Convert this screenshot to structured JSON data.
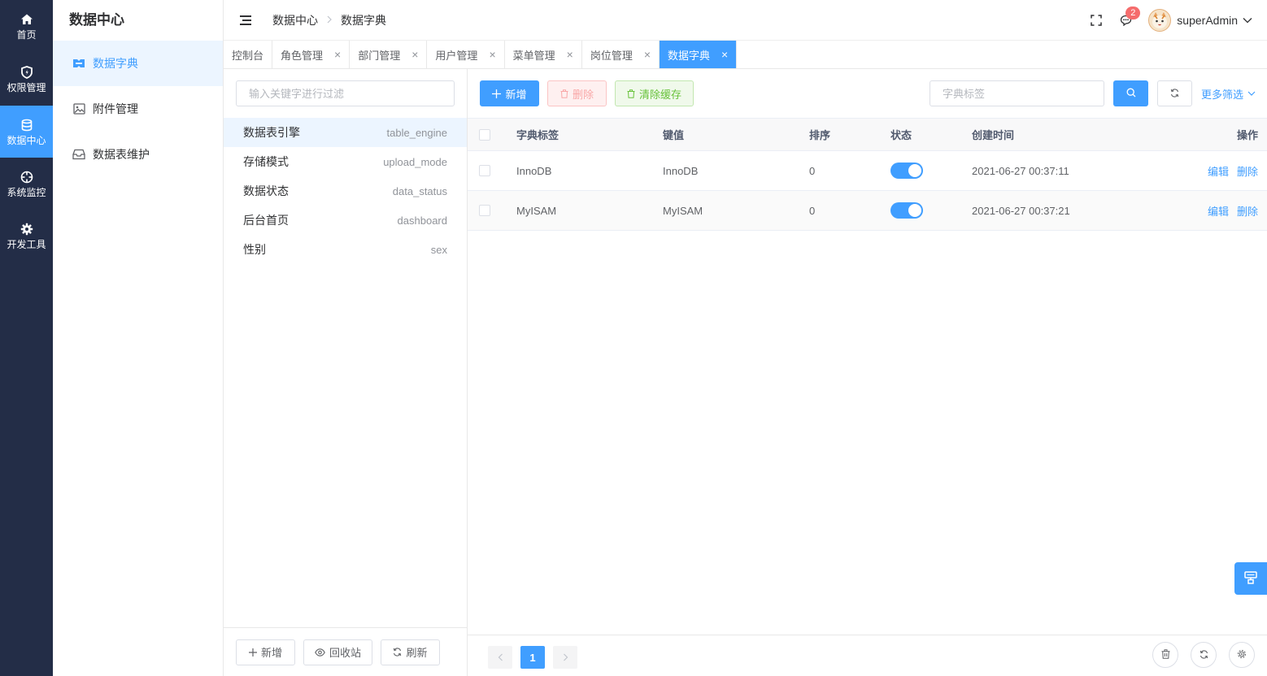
{
  "rail": {
    "items": [
      {
        "label": "首页",
        "icon": "home-icon"
      },
      {
        "label": "权限管理",
        "icon": "shield-icon"
      },
      {
        "label": "数据中心",
        "icon": "database-icon"
      },
      {
        "label": "系统监控",
        "icon": "target-icon"
      },
      {
        "label": "开发工具",
        "icon": "gear-icon"
      }
    ],
    "active_index": 2
  },
  "sidebar": {
    "title": "数据中心",
    "items": [
      {
        "label": "数据字典",
        "icon": "dictionary-icon"
      },
      {
        "label": "附件管理",
        "icon": "image-icon"
      },
      {
        "label": "数据表维护",
        "icon": "inbox-icon"
      }
    ]
  },
  "header": {
    "breadcrumb": [
      "数据中心",
      "数据字典"
    ],
    "notification_count": "2",
    "username": "superAdmin"
  },
  "tabs": [
    {
      "label": "控制台",
      "closable": false
    },
    {
      "label": "角色管理",
      "closable": true
    },
    {
      "label": "部门管理",
      "closable": true
    },
    {
      "label": "用户管理",
      "closable": true
    },
    {
      "label": "菜单管理",
      "closable": true
    },
    {
      "label": "岗位管理",
      "closable": true
    },
    {
      "label": "数据字典",
      "closable": true,
      "active": true
    }
  ],
  "dict_panel": {
    "filter_placeholder": "输入关键字进行过滤",
    "items": [
      {
        "name": "数据表引擎",
        "code": "table_engine"
      },
      {
        "name": "存储模式",
        "code": "upload_mode"
      },
      {
        "name": "数据状态",
        "code": "data_status"
      },
      {
        "name": "后台首页",
        "code": "dashboard"
      },
      {
        "name": "性别",
        "code": "sex"
      }
    ],
    "footer": {
      "add": "新增",
      "recycle": "回收站",
      "refresh": "刷新"
    }
  },
  "toolbar": {
    "add": "新增",
    "delete": "删除",
    "clear_cache": "清除缓存",
    "search_placeholder": "字典标签",
    "more_filter": "更多筛选"
  },
  "table": {
    "headers": {
      "label": "字典标签",
      "value": "键值",
      "sort": "排序",
      "status": "状态",
      "created": "创建时间",
      "actions": "操作"
    },
    "rows": [
      {
        "label": "InnoDB",
        "value": "InnoDB",
        "sort": "0",
        "status": true,
        "created": "2021-06-27 00:37:11"
      },
      {
        "label": "MyISAM",
        "value": "MyISAM",
        "sort": "0",
        "status": true,
        "created": "2021-06-27 00:37:21"
      }
    ],
    "edit": "编辑",
    "delete": "删除"
  },
  "pagination": {
    "current_page": "1"
  },
  "colors": {
    "primary": "#409eff",
    "rail_bg": "#232d47",
    "danger": "#f56c6c",
    "success": "#67c23a"
  }
}
